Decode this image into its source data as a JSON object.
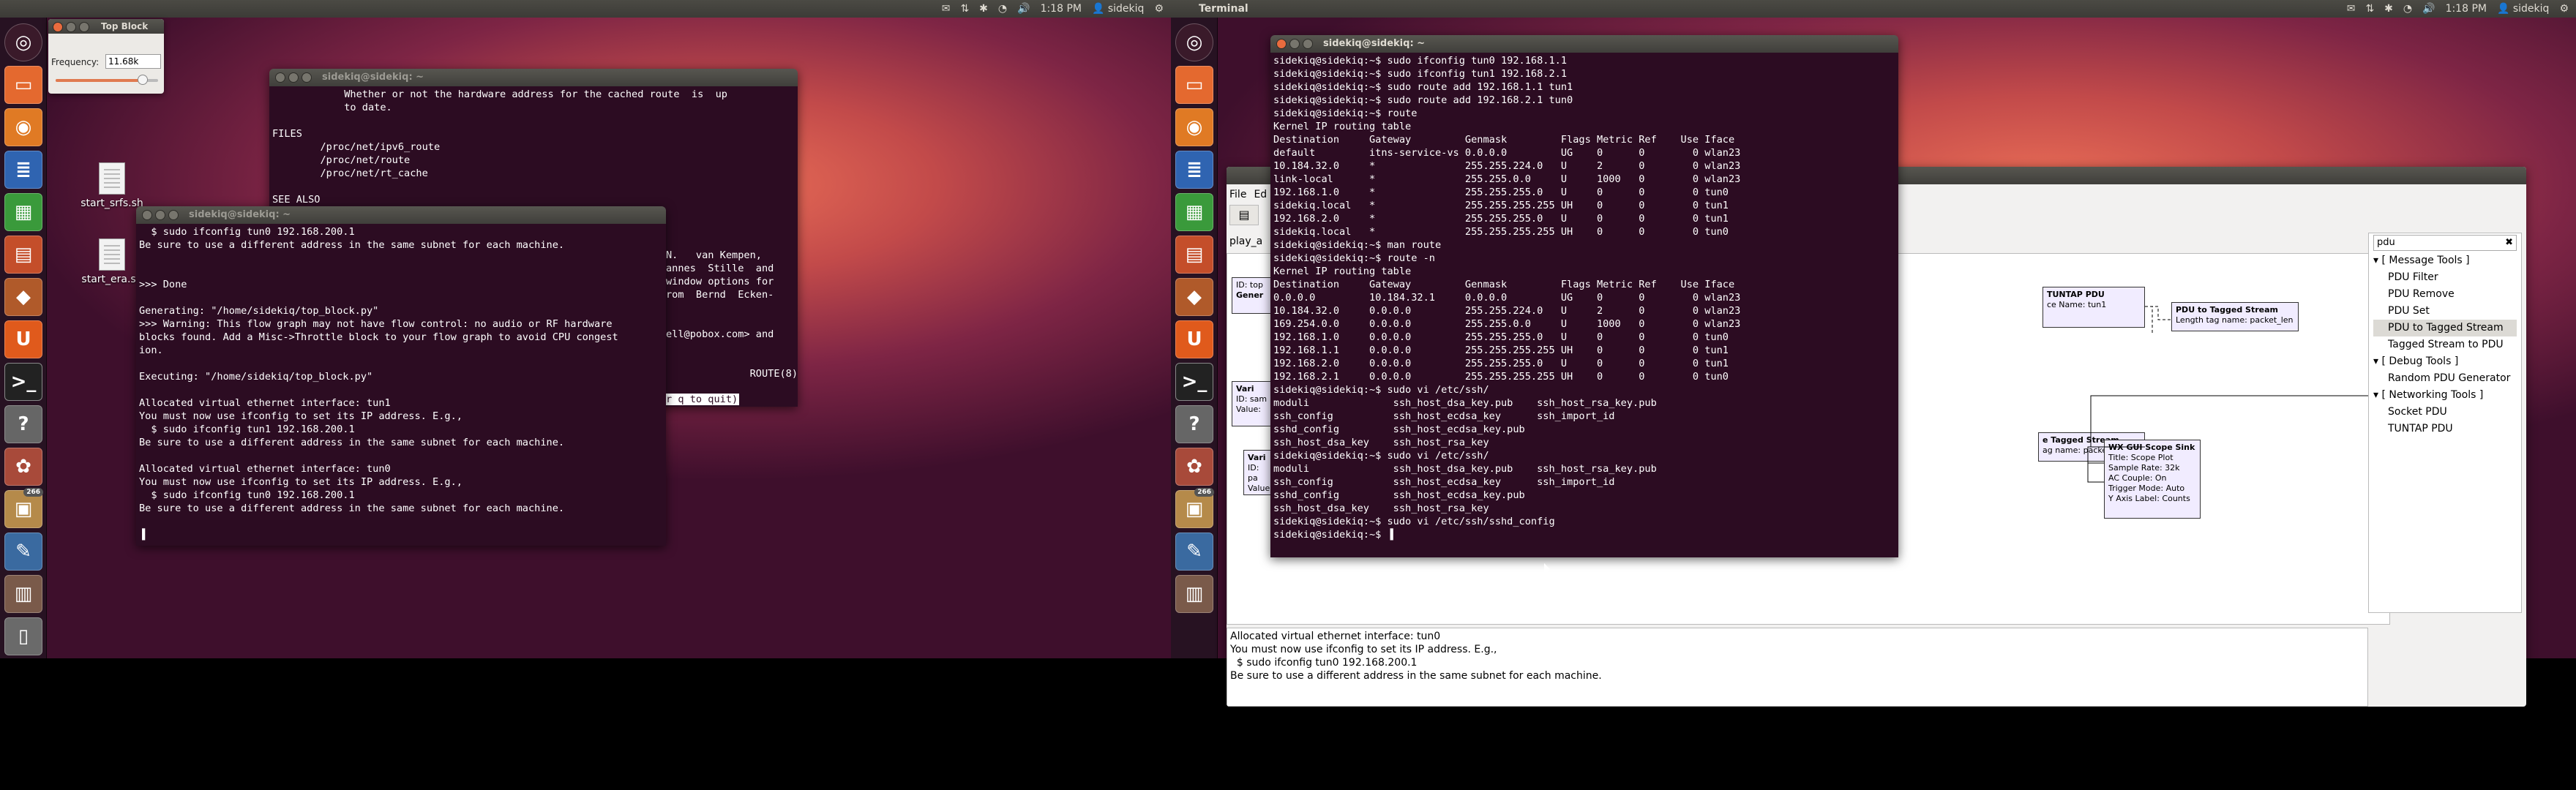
{
  "left_screen": {
    "topbar": {
      "tray": [
        "✉",
        "⇅",
        "✱",
        "◔",
        "🔊",
        "1:18 PM",
        "👤 sidekiq",
        "⚙"
      ]
    },
    "top_block": {
      "title": "Top Block",
      "freq_label": "Frequency:",
      "freq_value": "11.68k",
      "slider_fraction": 0.85
    },
    "desktop_icons": [
      "start_srfs.sh",
      "start_era.sh"
    ],
    "man_window": {
      "title": "sidekiq@sidekiq: ~",
      "text": "            Whether or not the hardware address for the cached route  is  up\n            to date.\n\nFILES\n        /proc/net/ipv6_route\n        /proc/net/route\n        /proc/net/rt_cache\n\nSEE ALSO\n",
      "side_text": "N.   van Kempen,\nannes  Stille  and\nwindow options for\nrom  Bernd  Ecken-\n\n\nell@pobox.com> and\n\n\n              ROUTE(8)",
      "quit_text": "r q to quit)"
    },
    "term_window": {
      "title": "sidekiq@sidekiq: ~",
      "text": "  $ sudo ifconfig tun0 192.168.200.1\nBe sure to use a different address in the same subnet for each machine.\n\n\n>>> Done\n\nGenerating: \"/home/sidekiq/top_block.py\"\n>>> Warning: This flow graph may not have flow control: no audio or RF hardware\nblocks found. Add a Misc->Throttle block to your flow graph to avoid CPU congest\nion.\n\nExecuting: \"/home/sidekiq/top_block.py\"\n\nAllocated virtual ethernet interface: tun1\nYou must now use ifconfig to set its IP address. E.g.,\n  $ sudo ifconfig tun1 192.168.200.1\nBe sure to use a different address in the same subnet for each machine.\n\nAllocated virtual ethernet interface: tun0\nYou must now use ifconfig to set its IP address. E.g.,\n  $ sudo ifconfig tun0 192.168.200.1\nBe sure to use a different address in the same subnet for each machine.\n\n▐"
    }
  },
  "right_screen": {
    "topbar": {
      "title": "Terminal",
      "tray": [
        "✉",
        "⇅",
        "✱",
        "◔",
        "🔊",
        "1:18 PM",
        "👤 sidekiq",
        "⚙"
      ]
    },
    "terminal": {
      "title": "sidekiq@sidekiq: ~",
      "text": "sidekiq@sidekiq:~$ sudo ifconfig tun0 192.168.1.1\nsidekiq@sidekiq:~$ sudo ifconfig tun1 192.168.2.1\nsidekiq@sidekiq:~$ sudo route add 192.168.1.1 tun1\nsidekiq@sidekiq:~$ sudo route add 192.168.2.1 tun0\nsidekiq@sidekiq:~$ route\nKernel IP routing table\nDestination     Gateway         Genmask         Flags Metric Ref    Use Iface\ndefault         itns-service-vs 0.0.0.0         UG    0      0        0 wlan23\n10.184.32.0     *               255.255.224.0   U     2      0        0 wlan23\nlink-local      *               255.255.0.0     U     1000   0        0 wlan23\n192.168.1.0     *               255.255.255.0   U     0      0        0 tun0\nsidekiq.local   *               255.255.255.255 UH    0      0        0 tun1\n192.168.2.0     *               255.255.255.0   U     0      0        0 tun1\nsidekiq.local   *               255.255.255.255 UH    0      0        0 tun0\nsidekiq@sidekiq:~$ man route\nsidekiq@sidekiq:~$ route -n\nKernel IP routing table\nDestination     Gateway         Genmask         Flags Metric Ref    Use Iface\n0.0.0.0         10.184.32.1     0.0.0.0         UG    0      0        0 wlan23\n10.184.32.0     0.0.0.0         255.255.224.0   U     2      0        0 wlan23\n169.254.0.0     0.0.0.0         255.255.0.0     U     1000   0        0 wlan23\n192.168.1.0     0.0.0.0         255.255.255.0   U     0      0        0 tun0\n192.168.1.1     0.0.0.0         255.255.255.255 UH    0      0        0 tun1\n192.168.2.0     0.0.0.0         255.255.255.0   U     0      0        0 tun1\n192.168.2.1     0.0.0.0         255.255.255.255 UH    0      0        0 tun0\nsidekiq@sidekiq:~$ sudo vi /etc/ssh/\nmoduli              ssh_host_dsa_key.pub    ssh_host_rsa_key.pub\nssh_config          ssh_host_ecdsa_key      ssh_import_id\nsshd_config         ssh_host_ecdsa_key.pub\nssh_host_dsa_key    ssh_host_rsa_key\nsidekiq@sidekiq:~$ sudo vi /etc/ssh/\nmoduli              ssh_host_dsa_key.pub    ssh_host_rsa_key.pub\nssh_config          ssh_host_ecdsa_key      ssh_import_id\nsshd_config         ssh_host_ecdsa_key.pub\nssh_host_dsa_key    ssh_host_rsa_key\nsidekiq@sidekiq:~$ sudo vi /etc/ssh/sshd_config\nsidekiq@sidekiq:~$ ▐"
    },
    "grc": {
      "menu": [
        "File",
        "Ed"
      ],
      "tab": "play_a",
      "blocks": {
        "tuntap": {
          "title": "TUNTAP PDU",
          "line": "ce Name: tun1"
        },
        "pdu_to_tagged_1": {
          "title": "PDU to Tagged Stream",
          "line": "Length tag name: packet_len"
        },
        "tagged_to_pdu": {
          "title": "e Tagged Stream",
          "line": "ag name: packet_len"
        },
        "scope": {
          "title": "WX GUI Scope Sink",
          "lines": [
            "Title: Scope Plot",
            "Sample Rate: 32k",
            "AC Couple: On",
            "Trigger Mode: Auto",
            "Y Axis Label: Counts"
          ]
        },
        "left_stubs": [
          "ID: top",
          "Gener",
          "Vari",
          "ID: sam",
          "Value:",
          "Vari",
          "ID: pa",
          "Value"
        ]
      },
      "search": {
        "value": "pdu"
      },
      "tree": [
        {
          "label": "[ Message Tools ]",
          "kind": "cat"
        },
        {
          "label": "PDU Filter",
          "kind": "item"
        },
        {
          "label": "PDU Remove",
          "kind": "item"
        },
        {
          "label": "PDU Set",
          "kind": "item"
        },
        {
          "label": "PDU to Tagged Stream",
          "kind": "sel"
        },
        {
          "label": "Tagged Stream to PDU",
          "kind": "item"
        },
        {
          "label": "[ Debug Tools ]",
          "kind": "cat"
        },
        {
          "label": "Random PDU Generator",
          "kind": "item"
        },
        {
          "label": "[ Networking Tools ]",
          "kind": "cat"
        },
        {
          "label": "Socket PDU",
          "kind": "item"
        },
        {
          "label": "TUNTAP PDU",
          "kind": "item"
        }
      ],
      "console": "Allocated virtual ethernet interface: tun0\nYou must now use ifconfig to set its IP address. E.g.,\n  $ sudo ifconfig tun0 192.168.200.1\nBe sure to use a different address in the same subnet for each machine."
    }
  }
}
